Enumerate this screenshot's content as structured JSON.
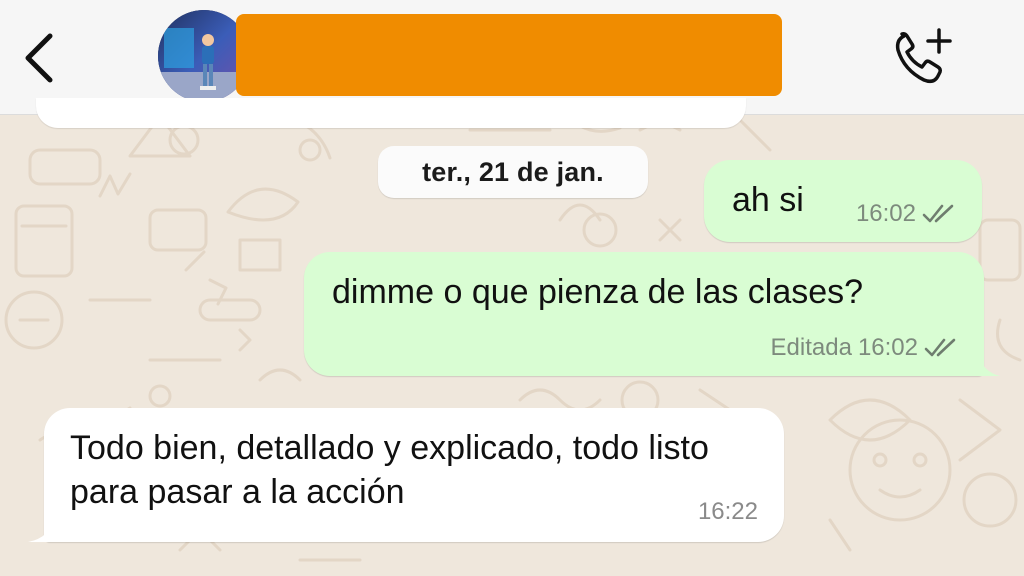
{
  "header": {
    "back_icon": "chevron-left-icon",
    "avatar": "contact-avatar-photo",
    "contact_name": "",
    "call_icon": "phone-add-icon"
  },
  "conversation": {
    "date_divider": "ter., 21 de jan.",
    "messages": [
      {
        "direction": "outgoing",
        "text": "ah si",
        "edited_label": "",
        "time": "16:02",
        "status": "read-double-check"
      },
      {
        "direction": "outgoing",
        "text": "dimme o que pienza de las clases?",
        "edited_label": "Editada",
        "time": "16:02",
        "status": "read-double-check"
      },
      {
        "direction": "incoming",
        "text": "Todo bien, detallado y explicado, todo listo para pasar a la acción",
        "edited_label": "",
        "time": "16:22",
        "status": ""
      }
    ]
  },
  "colors": {
    "header_bg": "#f6f6f6",
    "chat_wallpaper": "#efe7dc",
    "outgoing_bubble": "#d9fdd3",
    "incoming_bubble": "#ffffff",
    "name_redaction": "#f08c00"
  }
}
